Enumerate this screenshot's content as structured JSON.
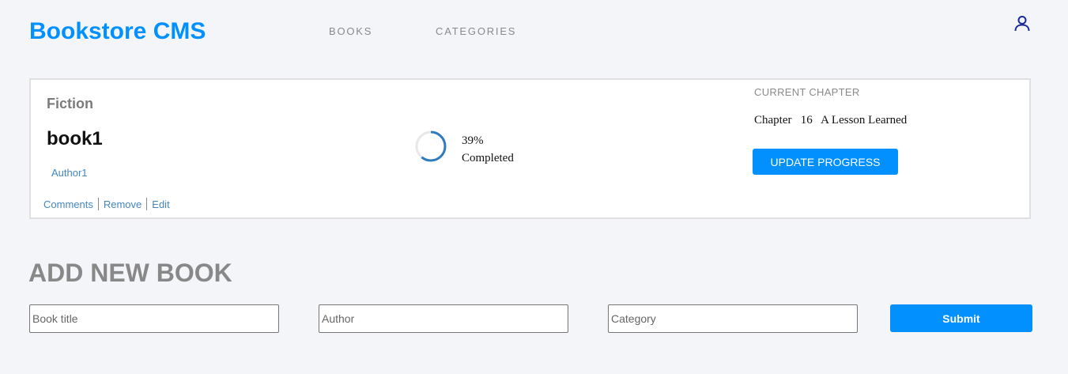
{
  "header": {
    "brand": "Bookstore CMS",
    "nav": {
      "books": "BOOKS",
      "categories": "CATEGORIES"
    },
    "user_icon": "user-icon"
  },
  "book": {
    "genre": "Fiction",
    "title": "book1",
    "author": "Author1",
    "actions": {
      "comments": "Comments",
      "remove": "Remove",
      "edit": "Edit"
    },
    "progress": {
      "percent": 39,
      "percent_text": "39%",
      "label": "Completed"
    },
    "chapter": {
      "heading": "CURRENT CHAPTER",
      "text": "Chapter   16   A Lesson Learned"
    },
    "update_label": "UPDATE PROGRESS"
  },
  "add_book": {
    "heading": "ADD NEW BOOK",
    "title_placeholder": "Book title",
    "author_placeholder": "Author",
    "category_placeholder": "Category",
    "submit_label": "Submit"
  },
  "colors": {
    "accent": "#0290ff",
    "link": "#4386bf",
    "ring": "#307bbe",
    "background": "#f4f5f9"
  }
}
